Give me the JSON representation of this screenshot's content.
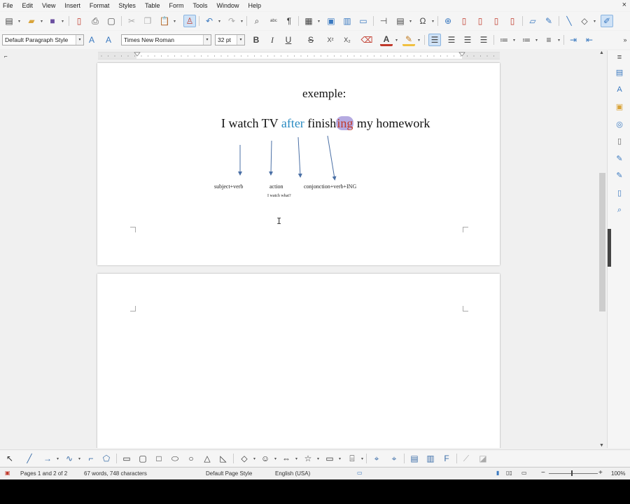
{
  "menu": [
    "File",
    "Edit",
    "View",
    "Insert",
    "Format",
    "Styles",
    "Table",
    "Form",
    "Tools",
    "Window",
    "Help"
  ],
  "window_close": "×",
  "toolbar": {
    "paragraph_style": "Default Paragraph Style",
    "font_name": "Times New Roman",
    "font_size": "32 pt",
    "bold": "B",
    "italic": "I",
    "underline": "U",
    "strikethrough": "S",
    "superscript": "X²",
    "subscript": "X₂"
  },
  "document": {
    "heading": "exemple:",
    "sentence": {
      "part1": "I watch TV ",
      "part2": "after",
      "part3": " finish",
      "part4": "ing",
      "part5": " my homework"
    },
    "labels": {
      "subject_verb": "subject+verb",
      "action": "action",
      "action_note": "I watch what?",
      "conjunction": "conjonction+verb+ING"
    }
  },
  "status": {
    "pages": "Pages 1 and 2 of 2",
    "words": "67 words, 748 characters",
    "page_style": "Default Page Style",
    "language": "English (USA)",
    "zoom": "100%"
  },
  "colors": {
    "highlight_blue": "#2a8bc2",
    "ing_red": "#c0392b",
    "ing_highlight": "#7864c8",
    "arrow": "#4a6fa5"
  }
}
